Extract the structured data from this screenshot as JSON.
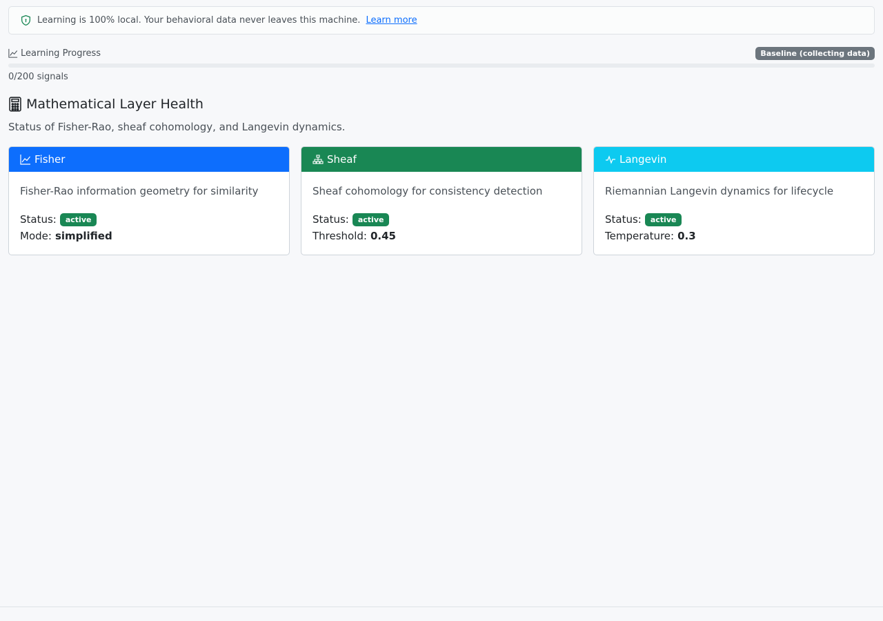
{
  "notice": {
    "text": "Learning is 100% local. Your behavioral data never leaves this machine.",
    "link": "Learn more"
  },
  "progress": {
    "label": "Learning Progress",
    "badge": "Baseline (collecting data)",
    "signals_text": "0/200 signals",
    "fraction": 0
  },
  "section": {
    "title": "Mathematical Layer Health",
    "subtitle": "Status of Fisher-Rao, sheaf cohomology, and Langevin dynamics."
  },
  "cards": [
    {
      "title": "Fisher",
      "icon": "line-chart-icon",
      "color": "#0d6efd",
      "desc": "Fisher-Rao information geometry for similarity",
      "status_label": "Status:",
      "status": "active",
      "param_label": "Mode:",
      "param_value": "simplified"
    },
    {
      "title": "Sheaf",
      "icon": "diagram-icon",
      "color": "#198754",
      "desc": "Sheaf cohomology for consistency detection",
      "status_label": "Status:",
      "status": "active",
      "param_label": "Threshold:",
      "param_value": "0.45"
    },
    {
      "title": "Langevin",
      "icon": "activity-icon",
      "color": "#0dcaf0",
      "desc": "Riemannian Langevin dynamics for lifecycle",
      "status_label": "Status:",
      "status": "active",
      "param_label": "Temperature:",
      "param_value": "0.3"
    }
  ]
}
